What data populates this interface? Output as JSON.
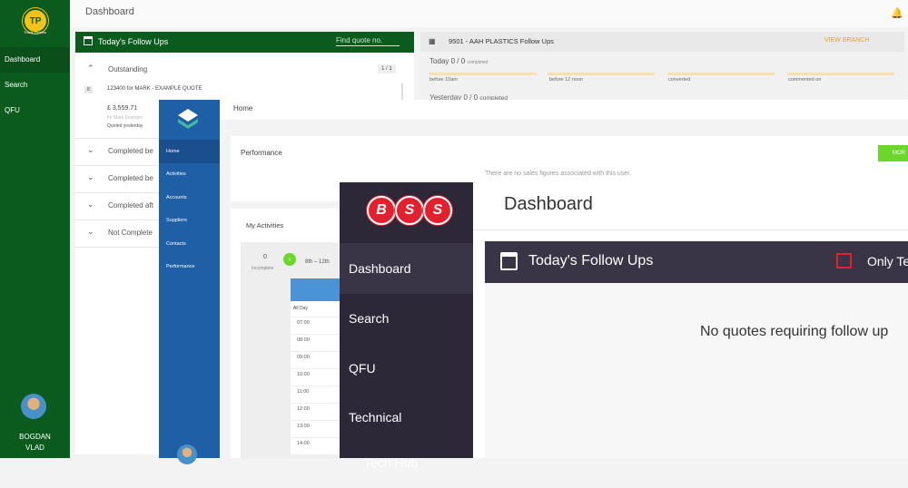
{
  "app1": {
    "logo_text": "TP",
    "logo_caption": "Travis Perkins",
    "nav": [
      "Dashboard",
      "Search",
      "QFU"
    ],
    "user_first": "BOGDAN",
    "user_last": "VLAD",
    "page_title": "Dashboard",
    "followups": {
      "title": "Today's Follow Ups",
      "find_placeholder": "Find quote no.",
      "outstanding": "Outstanding",
      "outstanding_count": "1 / 1",
      "quote_badge": "8",
      "quote_line": "123400 for MARK - EXAMPLE QUOTE",
      "quote_amount": "£ 3,559.71",
      "quote_sub": "for Mark Example",
      "quoted": "Quoted yesterday",
      "sections": [
        "Completed be",
        "Completed be",
        "Completed aft",
        "Not Complete"
      ]
    },
    "branch": {
      "title": "9501 - AAH PLASTICS Follow Ups",
      "view_branch": "VIEW BRANCH",
      "today": "Today 0 / 0",
      "today_small": "completed",
      "yesterday": "Yesterday 0 / 0",
      "yesterday_small": "completed",
      "stats": [
        "before 10am",
        "before 12 noon",
        "converted",
        "commented on"
      ]
    },
    "colors": {
      "primary": "#0b5b1e",
      "accent": "#e4a61b"
    }
  },
  "app2": {
    "nav": [
      "Home",
      "Activities",
      "Accounts",
      "Suppliers",
      "Contacts",
      "Performance"
    ],
    "page_title": "Home",
    "performance": {
      "title": "Performance",
      "message": "There are no sales figures associated with this user.",
      "more": "MOR"
    },
    "activities": {
      "title": "My Activities",
      "incomplete_count": "0",
      "incomplete_label": "Incomplete",
      "range": "8th – 12th",
      "all_day": "All Day",
      "hours": [
        "07:00",
        "08:00",
        "09:00",
        "10:00",
        "11:00",
        "12:00",
        "13:00",
        "14:00"
      ]
    },
    "colors": {
      "primary": "#1e5fa6",
      "go": "#6cd62c"
    }
  },
  "app3": {
    "logo_letters": [
      "B",
      "S",
      "S"
    ],
    "nav": [
      "Dashboard",
      "Search",
      "QFU",
      "Technical",
      "Tech Hub"
    ],
    "page_title": "Dashboard",
    "followups": {
      "title": "Today's Follow Ups",
      "only_label": "Only Te",
      "empty": "No quotes requiring follow up"
    },
    "colors": {
      "primary": "#2d2838",
      "brand": "#e4202f"
    }
  }
}
